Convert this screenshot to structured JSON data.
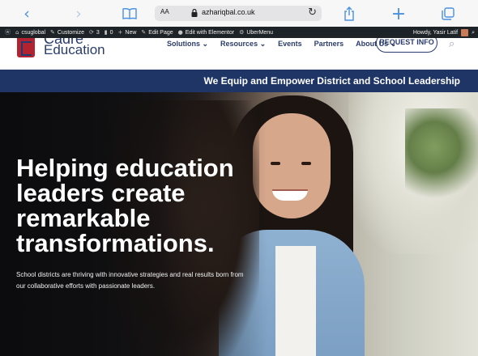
{
  "browser": {
    "text_size_label": "AA",
    "domain": "azhariqbal.co.uk"
  },
  "wp_admin_bar": {
    "items": [
      {
        "label": "csuglobal"
      },
      {
        "label": "Customize"
      },
      {
        "label": "3"
      },
      {
        "label": "0"
      },
      {
        "label": "New"
      },
      {
        "label": "Edit Page"
      },
      {
        "label": "Edit with Elementor"
      },
      {
        "label": "UberMenu"
      }
    ],
    "howdy": "Howdy, Yasir Latif"
  },
  "site": {
    "logo_top": "Cadre",
    "logo_text": "Education",
    "nav": [
      {
        "label": "Solutions ⌄"
      },
      {
        "label": "Resources ⌄"
      },
      {
        "label": "Events"
      },
      {
        "label": "Partners"
      },
      {
        "label": "About Us ⌄"
      }
    ],
    "request_button": "REQUEST INFO",
    "banner": "We Equip and Empower District and School Leadership"
  },
  "hero": {
    "title": "Helping education leaders create remarkable transformations.",
    "subtitle": "School districts are thriving with innovative strategies and real results born from our collaborative efforts with passionate leaders."
  },
  "colors": {
    "brand_navy": "#1f3566",
    "brand_red": "#b3232f",
    "safari_accent": "#4a90e2",
    "wp_bar": "#1d2327"
  }
}
